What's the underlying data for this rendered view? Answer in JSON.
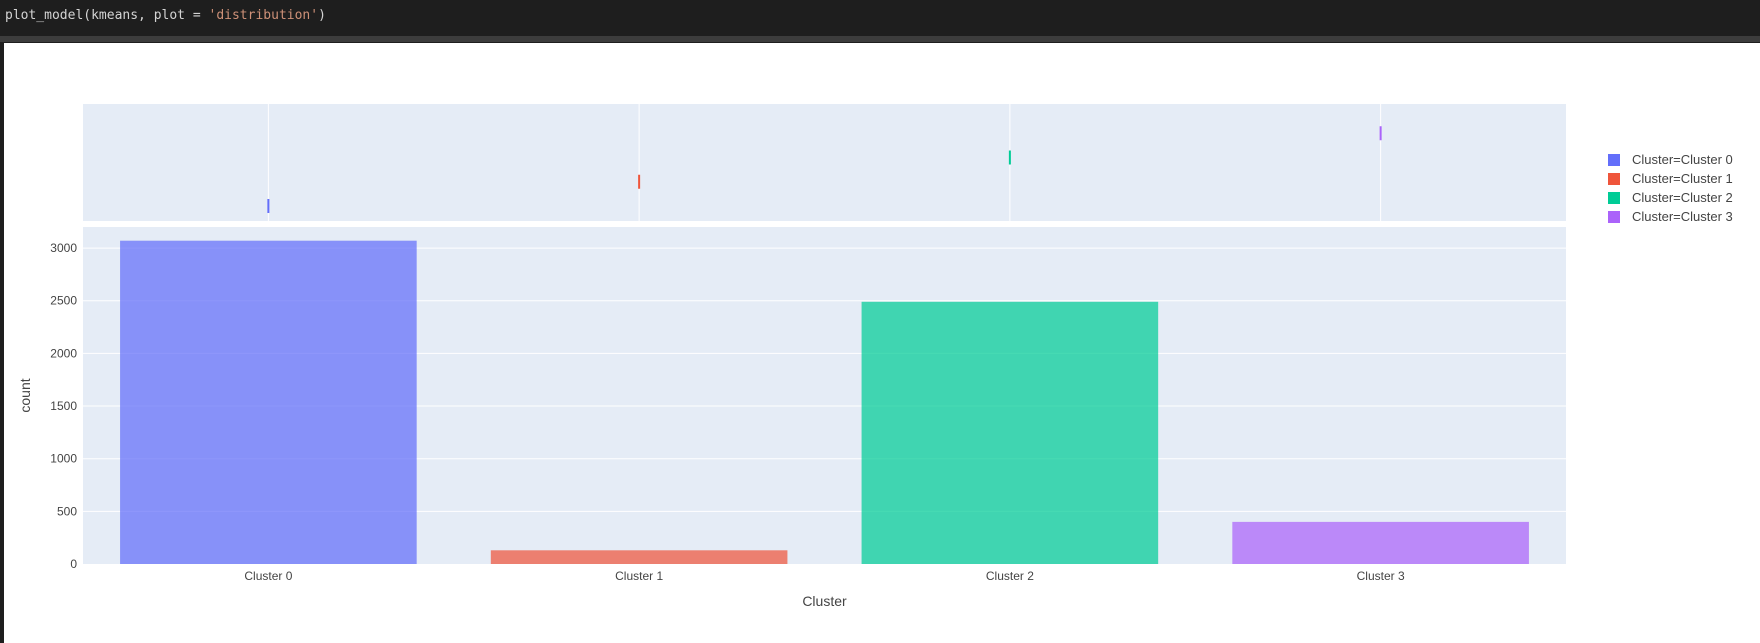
{
  "code": {
    "prefix": "plot_model(kmeans, plot = ",
    "string": "'distribution'",
    "suffix": ")"
  },
  "colors": {
    "cluster0": "#636efa",
    "cluster1": "#ef553b",
    "cluster2": "#00cc96",
    "cluster3": "#ab63fa",
    "plot_bg": "#e5ecf6",
    "grid": "#ffffff"
  },
  "legend": {
    "items": [
      {
        "label": "Cluster=Cluster 0",
        "color": "#636efa"
      },
      {
        "label": "Cluster=Cluster 1",
        "color": "#ef553b"
      },
      {
        "label": "Cluster=Cluster 2",
        "color": "#00cc96"
      },
      {
        "label": "Cluster=Cluster 3",
        "color": "#ab63fa"
      }
    ]
  },
  "chart_data": {
    "type": "bar",
    "categories": [
      "Cluster 0",
      "Cluster 1",
      "Cluster 2",
      "Cluster 3"
    ],
    "values": [
      3070,
      130,
      2490,
      400
    ],
    "xlabel": "Cluster",
    "ylabel": "count",
    "ylim": [
      0,
      3200
    ],
    "yticks": [
      0,
      500,
      1000,
      1500,
      2000,
      2500,
      3000
    ],
    "grid": true,
    "legend_position": "top-right",
    "marginal": "rug"
  }
}
